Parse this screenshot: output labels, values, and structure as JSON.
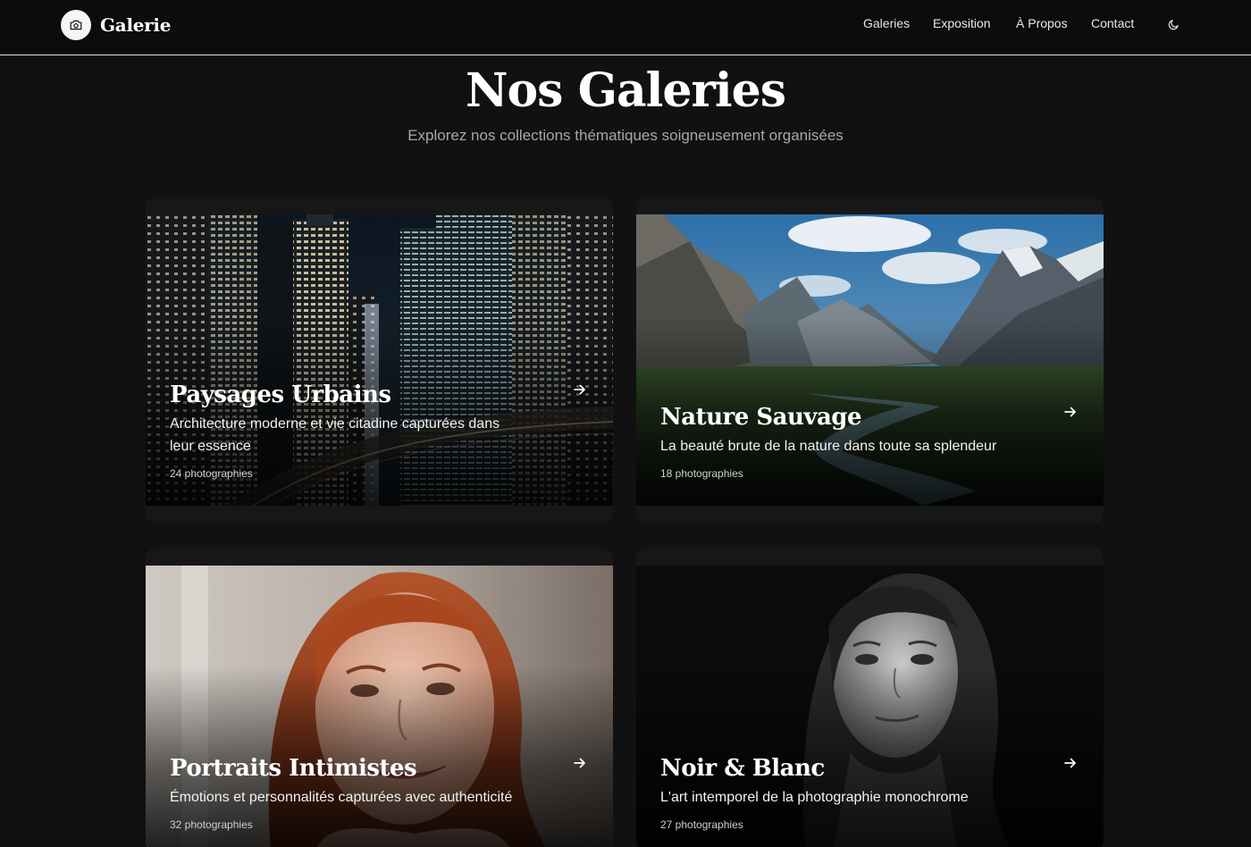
{
  "brand": {
    "name": "Galerie",
    "icon": "camera-icon"
  },
  "nav": {
    "items": [
      {
        "label": "Galeries"
      },
      {
        "label": "Exposition"
      },
      {
        "label": "À Propos"
      },
      {
        "label": "Contact"
      }
    ],
    "theme_toggle_icon": "moon-icon"
  },
  "hero": {
    "title": "Nos Galeries",
    "subtitle": "Explorez nos collections thématiques soigneusement organisées"
  },
  "galleries": [
    {
      "title": "Paysages Urbains",
      "description": "Architecture moderne et vie citadine capturées dans leur essence",
      "count": "24 photographies",
      "image": "city-night-skyline"
    },
    {
      "title": "Nature Sauvage",
      "description": "La beauté brute de la nature dans toute sa splendeur",
      "count": "18 photographies",
      "image": "mountain-valley-river"
    },
    {
      "title": "Portraits Intimistes",
      "description": "Émotions et personnalités capturées avec authenticité",
      "count": "32 photographies",
      "image": "red-hair-portrait"
    },
    {
      "title": "Noir & Blanc",
      "description": "L'art intemporel de la photographie monochrome",
      "count": "27 photographies",
      "image": "monochrome-portrait"
    }
  ],
  "colors": {
    "background": "#111111",
    "header": "#0c0c0c",
    "text": "#ffffff",
    "muted": "#a8a8a8"
  }
}
